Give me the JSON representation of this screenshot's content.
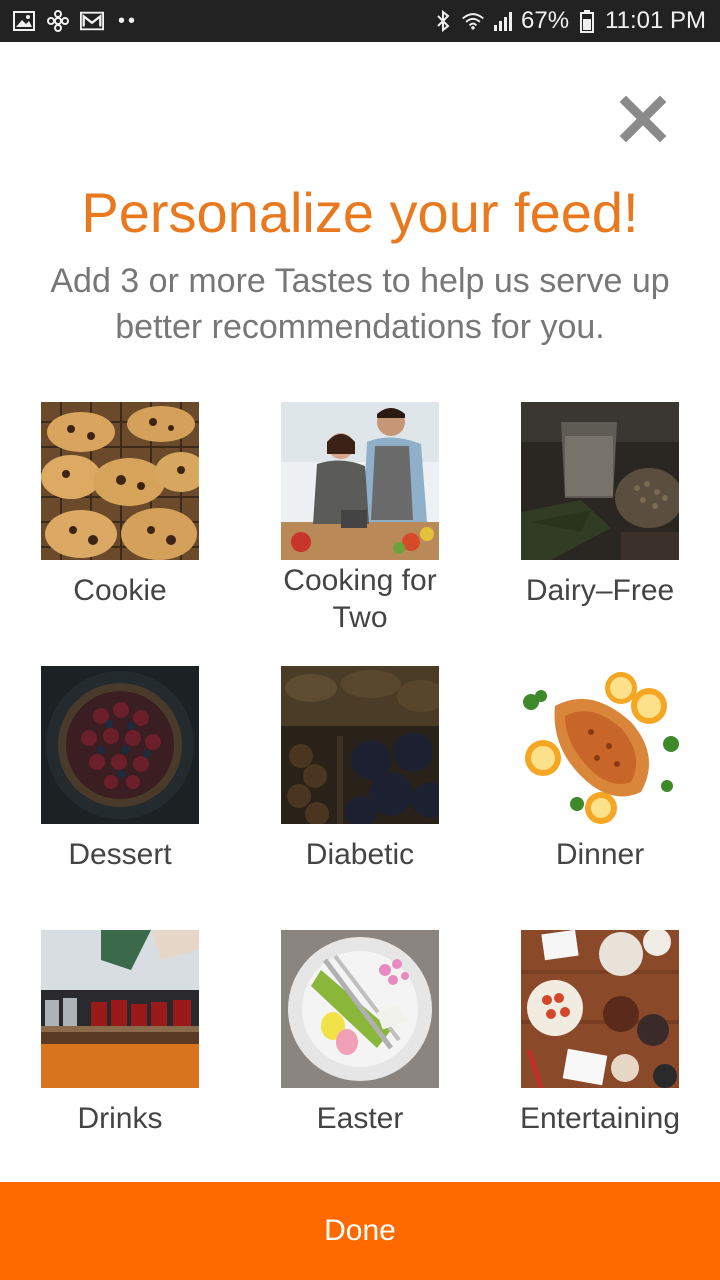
{
  "status_bar": {
    "battery": "67%",
    "time": "11:01 PM",
    "left_icons": [
      "image-icon",
      "pinwheel-icon",
      "gmail-icon"
    ],
    "dots": "••"
  },
  "dialog": {
    "title": "Personalize your feed!",
    "subtitle": "Add 3 or more Tastes to help us serve up better recommendations for you.",
    "close_icon": "close-icon",
    "accent_color": "#e8791f"
  },
  "tastes": [
    {
      "label": "Cookie"
    },
    {
      "label": "Cooking for Two"
    },
    {
      "label": "Dairy–Free"
    },
    {
      "label": "Dessert"
    },
    {
      "label": "Diabetic"
    },
    {
      "label": "Dinner"
    },
    {
      "label": "Drinks"
    },
    {
      "label": "Easter"
    },
    {
      "label": "Entertaining"
    }
  ],
  "done_button": {
    "label": "Done",
    "color": "#ff6a00"
  }
}
